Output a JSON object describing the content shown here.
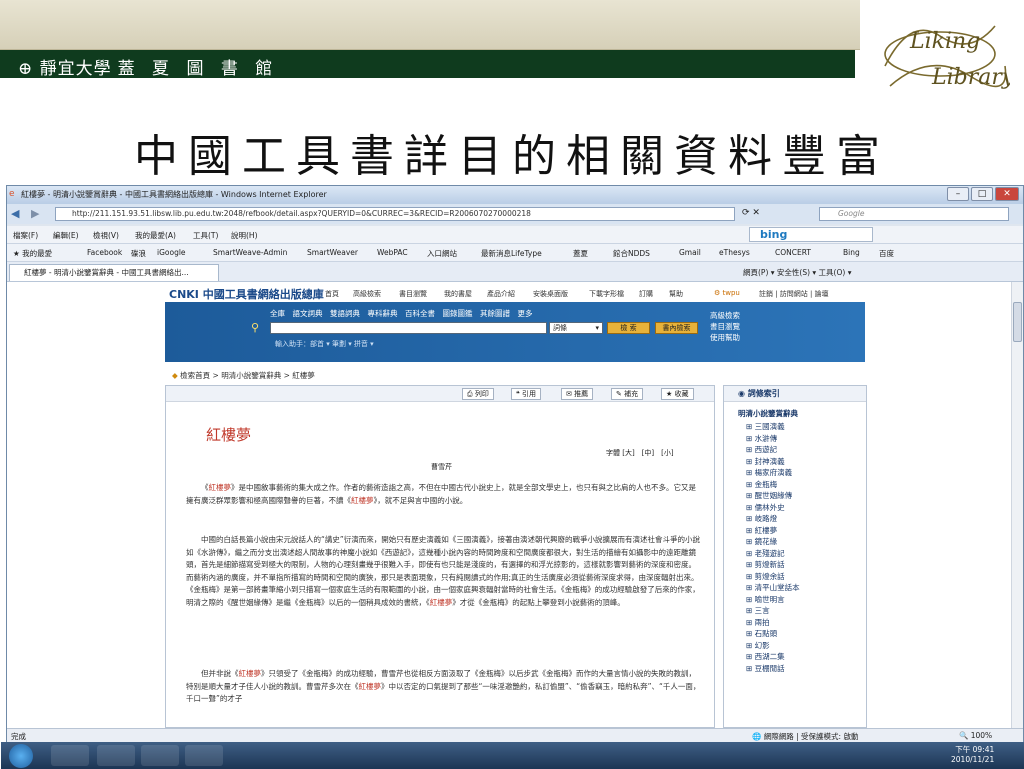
{
  "slide": {
    "university": "靜宜大學",
    "library": "蓋 夏 圖 書 館",
    "title": "中國工具書詳目的相關資料豐富",
    "logo_text": "Liking Library"
  },
  "window": {
    "title": "紅樓夢 - 明清小說鑒賞辭典 - 中國工具書網絡出版總庫 - Windows Internet Explorer",
    "address": "http://211.151.93.51.libsw.lib.pu.edu.tw:2048/refbook/detail.aspx?QUERYID=0&CURREC=3&RECID=R2006070270000218",
    "search_placeholder": "Google",
    "menu": [
      "檔案(F)",
      "編輯(E)",
      "檢視(V)",
      "我的最愛(A)",
      "工具(T)",
      "說明(H)"
    ],
    "bing": "bing",
    "favorites": [
      "我的最愛",
      "Facebook",
      "碟浪",
      "iGoogle",
      "SmartWeave-Admin",
      "SmartWeaver",
      "WebPAC",
      "入口網站",
      "最新消息LifeType",
      "蓋夏",
      "館合NDDS",
      "Gmail",
      "eThesys",
      "CONCERT",
      "Bing",
      "百度"
    ],
    "tab": "紅樓夢 - 明清小說鑒賞辭典 - 中國工具書網絡出...",
    "cmd": "網頁(P) ▾ 安全性(S) ▾ 工具(O) ▾"
  },
  "site": {
    "brand": "CNKI 中國工具書網絡出版總庫",
    "nav": [
      "首頁",
      "高級檢索",
      "書目瀏覽",
      "我的書屋",
      "產品介紹",
      "安裝桌面版",
      "下載字形檔",
      "訂購",
      "幫助"
    ],
    "user": "twpu",
    "links": "註銷 | 訪問網站 | 論壇",
    "tabs": "全庫　語文詞典　雙語詞典　專科辭典　百科全書　圖錄圖鑑　其餘圖譜　更多",
    "field": "詞條",
    "search": "檢 索",
    "search_in": "書內檢索",
    "helper": "輸入助手：部首 ▾ 筆劃 ▾ 拼音 ▾",
    "right_links": [
      "高級檢索",
      "書目瀏覽",
      "使用幫助"
    ],
    "breadcrumb": "檢索首頁 > 明清小說鑒賞辭典 > 紅樓夢"
  },
  "tools": [
    "列印",
    "引用",
    "推薦",
    "補充",
    "收藏"
  ],
  "entry": {
    "title": "紅樓夢",
    "fontsize": "字體 [大]　[中]　[小]",
    "author": "曹雪芹",
    "p1a": "《",
    "p1hl": "紅樓夢",
    "p1b": "》是中國敘事藝術的集大成之作。作者的藝術造詣之高，不但在中國古代小說史上，就是全部文學史上，也只有與之比肩的人也不多。它又是擁有廣泛群眾影響和極高國際聲譽的巨著，不讀《",
    "p1hl2": "紅樓夢",
    "p1c": "》，就不足與言中國的小說。",
    "p2": "中國的白話長篇小說由宋元說話人的“講史”衍演而來，開始只有歷史演義如《三國演義》，接著由演述朝代興廢的戰爭小說擴展而有演述社會斗爭的小說如《水滸傳》，繼之而分支出演述超人間故事的神魔小說如《西遊記》，這幾種小說內容的時間跨度和空間廣度都很大，對生活的描繪有如攝影中的遠距離鏡頭，首先是細節描寫受到極大的限制，人物的心理刻畫幾乎很難入手，即使有也只能是淺度的，有選擇的和浮光掠影的，這樣就影響到藝術的深度和密度。而藝術內涵的廣度，并不單指所描寫的時間和空間的廣狹，那只是表面現象，只有純閱讀式的作用;真正的生活廣度必須從藝術深度求得，由深度輻射出來。《金瓶梅》是第一部將畫筆縮小到只描寫一個家庭生活的有限範圍的小說，由一個家庭興衰輻射當時的社會生活。《金瓶梅》的成功經驗啟發了后來的作家，明清之際的《醒世姻緣傳》是繼《金瓶梅》以后的一個稍具成效的書統，《",
    "p2hl": "紅樓夢",
    "p2b": "》才從《金瓶梅》的起點上攀登到小說藝術的頂峰。",
    "p3a": "但并非說《",
    "p3hl": "紅樓夢",
    "p3b": "》只領受了《金瓶梅》的成功經驗，曹雪芹也從相反方面汲取了《金瓶梅》以后步武《金瓶梅》而作的大量言情小說的失敗的教訓，特別是順大量才子佳人小說的教訓。曹雪芹多次在《",
    "p3hl2": "紅樓夢",
    "p3c": "》中以否定的口氣提到了那些“一味淫邀艷約，私訂偷盟”、“偷香竊玉，暗約私奔”、“千人一面，千口一聲”的才子"
  },
  "index": {
    "head": "詞條索引",
    "dict": "明清小說鑒賞辭典",
    "items": [
      "三國演義",
      "水滸傳",
      "西遊記",
      "封神演義",
      "楊家府演義",
      "金瓶梅",
      "醒世姻緣傳",
      "儒林外史",
      "岐路燈",
      "紅樓夢",
      "鏡花緣",
      "老殘遊記",
      "剪燈新話",
      "剪燈余話",
      "清平山堂話本",
      "喻世明言",
      "三言",
      "兩拍",
      "石點頭",
      "幻影",
      "西湖二集",
      "豆棚閒話"
    ]
  },
  "status": {
    "left": "完成",
    "zone": "網際網路 | 受保護模式: 啟動",
    "zoom": "100%"
  },
  "clock": {
    "time": "下午 09:41",
    "date": "2010/11/21"
  }
}
